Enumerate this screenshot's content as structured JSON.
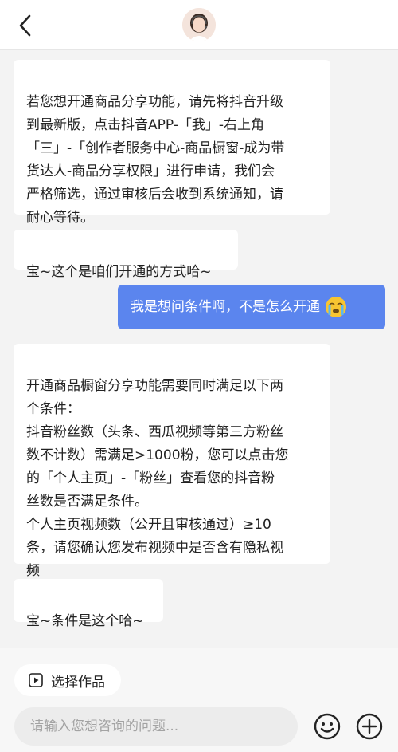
{
  "header": {
    "back_icon": "chevron-left-icon",
    "avatar_icon": "customer-service-avatar-icon"
  },
  "messages": [
    {
      "side": "in",
      "text": "若您想开通商品分享功能，请先将抖音升级\n到最新版，点击抖音APP-「我」-右上角\n「三」-「创作者服务中心-商品橱窗-成为带\n货达人-商品分享权限」进行申请，我们会\n严格筛选，通过审核后会收到系统通知，请\n耐心等待。"
    },
    {
      "side": "in",
      "text": "宝~这个是咱们开通的方式哈~"
    },
    {
      "side": "out",
      "text": "我是想问条件啊，不是怎么开通",
      "emoji": "crying-face-icon"
    },
    {
      "side": "in",
      "text": "开通商品橱窗分享功能需要同时满足以下两\n个条件：\n抖音粉丝数（头条、西瓜视频等第三方粉丝\n数不计数）需满足>1000粉，您可以点击您\n的「个人主页」-「粉丝」查看您的抖音粉\n丝数是否满足条件。\n个人主页视频数（公开且审核通过）≥10\n条，请您确认您发布视频中是否含有隐私视\n频"
    },
    {
      "side": "in",
      "text": "宝~条件是这个哈~"
    }
  ],
  "footer": {
    "select_works_label": "选择作品",
    "select_works_icon": "play-square-icon",
    "input_placeholder": "请输入您想咨询的问题...",
    "emoji_icon": "smiley-icon",
    "add_icon": "plus-circle-icon"
  },
  "colors": {
    "outgoing_bubble": "#5b85ee",
    "incoming_bubble": "#ffffff",
    "background": "#f3f3f3"
  }
}
